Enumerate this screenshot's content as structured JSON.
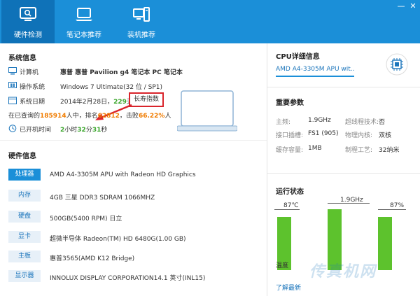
{
  "nav": {
    "items": [
      {
        "label": "硬件检测",
        "icon": "monitor-icon"
      },
      {
        "label": "笔记本推荐",
        "icon": "laptop-icon"
      },
      {
        "label": "装机推荐",
        "icon": "pc-build-icon"
      }
    ],
    "window_controls": [
      "—",
      "✕"
    ]
  },
  "system": {
    "title": "系统信息",
    "computer_label": "计算机",
    "computer_value": "惠普 惠普 Pavilion g4 笔记本 PC 笔记本",
    "os_label": "操作系统",
    "os_value": "Windows 7 Ultimate(32 位 / SP1)",
    "date_label": "系统日期",
    "date_value": "2014年2月28日，",
    "date_days": "229",
    "date_suffix": "天",
    "longevity_button": "长寿指数",
    "query_prefix": "在已查询的",
    "query_count": "185914",
    "query_mid": "人中，排名",
    "rank": "62812",
    "beat_prefix": "，击败",
    "beat_pct": "66.22%",
    "beat_suffix": "人",
    "uptime_label": "已开机时间",
    "uptime_hours": "2",
    "uptime_h_unit": "小时",
    "uptime_minutes": "32",
    "uptime_m_unit": "分",
    "uptime_seconds": "31",
    "uptime_s_unit": "秒"
  },
  "hardware": {
    "title": "硬件信息",
    "items": [
      {
        "tag": "处理器",
        "value": "AMD A4-3305M APU with Radeon HD Graphics"
      },
      {
        "tag": "内存",
        "value": "4GB 三星 DDR3 SDRAM 1066MHZ"
      },
      {
        "tag": "硬盘",
        "value": "500GB(5400 RPM) 日立"
      },
      {
        "tag": "显卡",
        "value": "超微半导体 Radeon(TM) HD 6480G(1.00 GB)"
      },
      {
        "tag": "主板",
        "value": "惠普3565(AMD K12 Bridge)"
      },
      {
        "tag": "显示器",
        "value": "INNOLUX DISPLAY CORPORATION14.1 英寸(INL15)"
      }
    ]
  },
  "cpu": {
    "title": "CPU详细信息",
    "dropdown_value": "AMD A4-3305M APU wit...",
    "params_title": "重要参数",
    "params": [
      {
        "label": "主频:",
        "value": "1.9GHz"
      },
      {
        "label": "超线程技术:",
        "value": "否"
      },
      {
        "label": "接口插槽:",
        "value": "FS1 (905)"
      },
      {
        "label": "物理内核:",
        "value": "双核"
      },
      {
        "label": "缓存容量:",
        "value": "1MB"
      },
      {
        "label": "制程工艺:",
        "value": "32纳米"
      }
    ],
    "status_title": "运行状态",
    "gauges": [
      {
        "label": "87℃",
        "level_percent": 87,
        "caption": "温度"
      },
      {
        "label": "1.9GHz",
        "level_percent": 100,
        "caption": ""
      },
      {
        "label": "87%",
        "level_percent": 87,
        "caption": ""
      }
    ],
    "footer_link": "了解最新",
    "watermark": "传真机网"
  },
  "colors": {
    "brand": "#1b8fd8",
    "active_nav": "#0f72b8",
    "highlight_orange": "#f07c00",
    "highlight_green": "#3aa52b",
    "gauge_green": "#5dc22d",
    "annotation_red": "#d9242b"
  }
}
